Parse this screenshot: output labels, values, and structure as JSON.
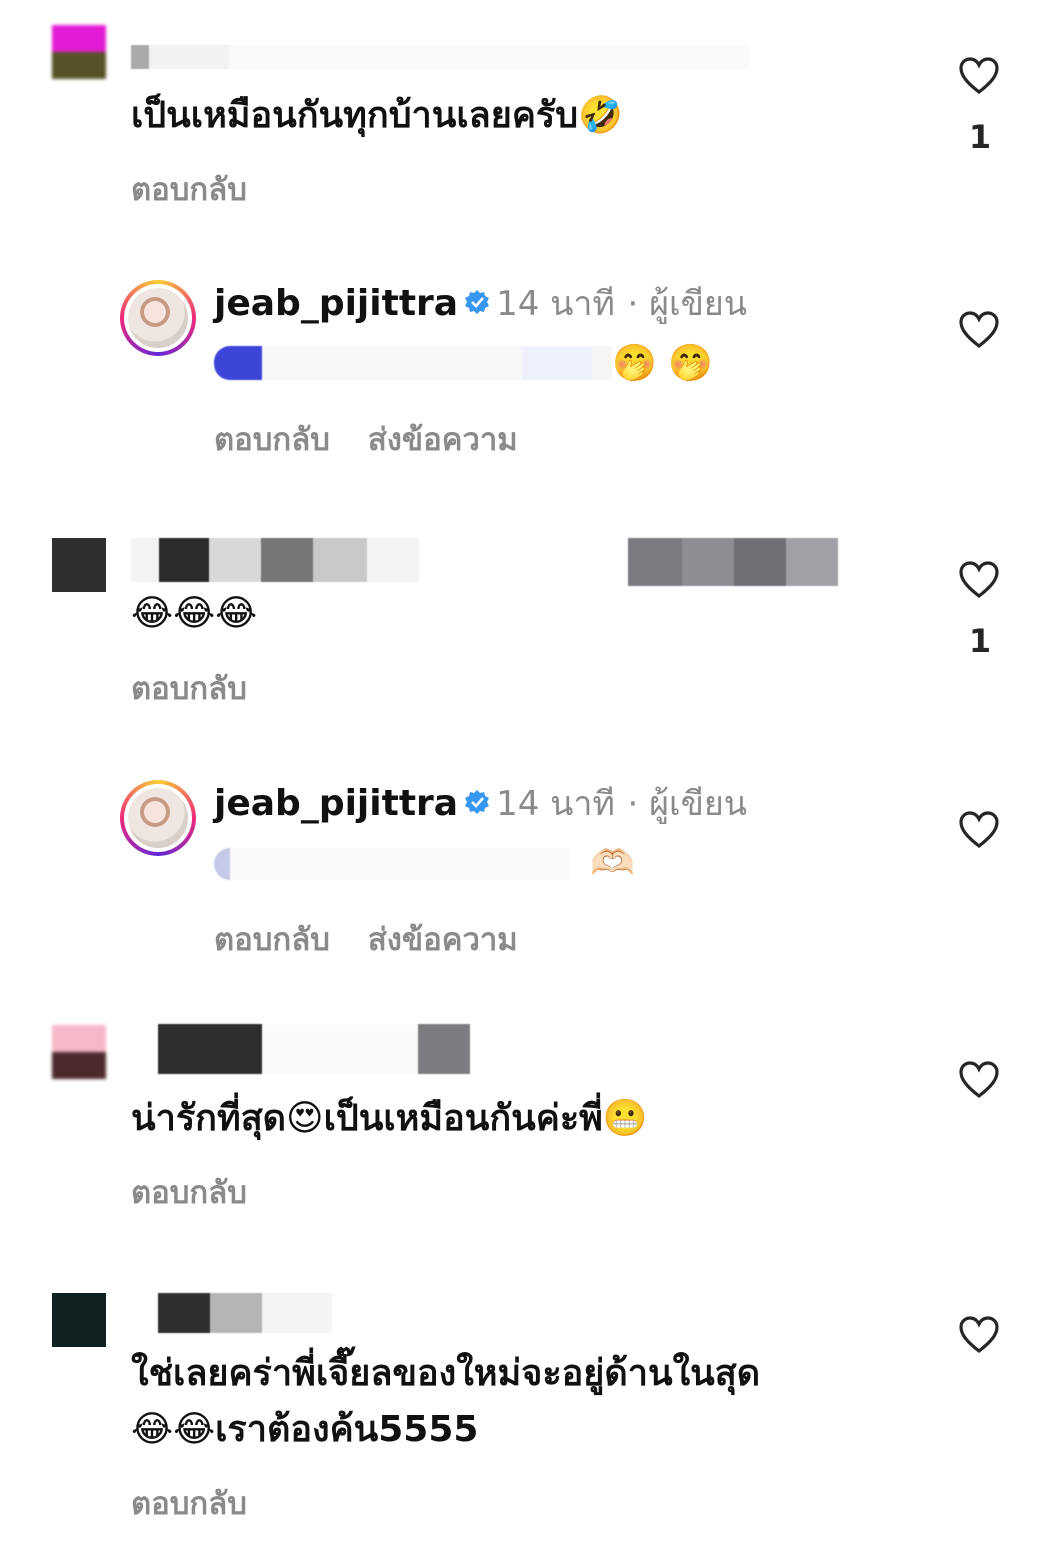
{
  "comments": [
    {
      "id": 1,
      "text": "เป็นเหมือนกันทุกบ้านเลยครับ🤣",
      "reply_label": "ตอบกลับ",
      "likes": "1",
      "avatar_colors": [
        "#e31bd4",
        "#565226"
      ]
    },
    {
      "id": 2,
      "text": "😂😂😂",
      "reply_label": "ตอบกลับ",
      "likes": "1",
      "avatar_colors": [
        "#2f2f2f",
        "#2f2f2f"
      ]
    },
    {
      "id": 3,
      "text": "น่ารักที่สุด😍เป็นเหมือนกันค่ะพี่😬",
      "reply_label": "ตอบกลับ",
      "likes": "",
      "avatar_colors": [
        "#f5b8c9",
        "#4a2a2c"
      ]
    },
    {
      "id": 4,
      "text_line1": "ใช่เลยคร่าพี่เจี๊ยลของใหม่จะอยู่ด้านในสุด",
      "text_line2": "😂😂เราต้องค้น5555",
      "reply_label": "ตอบกลับ",
      "likes": "",
      "avatar_colors": [
        "#0f2220",
        "#0f2220"
      ]
    }
  ],
  "author_replies": [
    {
      "username": "jeab_pijittra",
      "time": "14 นาที",
      "role": "· ผู้เขียน",
      "emoji": "🤭 🤭",
      "reply_label": "ตอบกลับ",
      "message_label": "ส่งข้อความ"
    },
    {
      "username": "jeab_pijittra",
      "time": "14 นาที",
      "role": "· ผู้เขียน",
      "emoji": "🫶🏻",
      "reply_label": "ตอบกลับ",
      "message_label": "ส่งข้อความ"
    }
  ],
  "colors": {
    "verified": "#3897f0",
    "muted": "#8a8a8a",
    "text": "#111111"
  },
  "icons": {
    "like": "heart-outline-icon",
    "verified": "verified-badge-icon"
  }
}
